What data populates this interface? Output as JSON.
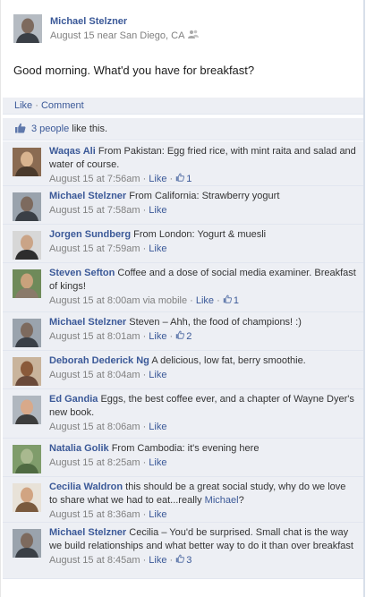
{
  "post": {
    "author": "Michael Stelzner",
    "time": "August 15 near San Diego, CA",
    "message": "Good morning. What'd you have for breakfast?"
  },
  "actions": {
    "like": "Like",
    "separator": "·",
    "comment": "Comment"
  },
  "likes": {
    "count_link": "3 people",
    "suffix": "like this."
  },
  "comments": [
    {
      "author": "Waqas Ali",
      "text": "From Pakistan: Egg fried rice, with mint raita and salad and water of course.",
      "time": "August 15 at 7:56am",
      "like": "Like",
      "likes": "1"
    },
    {
      "author": "Michael Stelzner",
      "text": "From California: Strawberry yogurt",
      "time": "August 15 at 7:58am",
      "like": "Like",
      "likes": ""
    },
    {
      "author": "Jorgen Sundberg",
      "text": "From London: Yogurt & muesli",
      "time": "August 15 at 7:59am",
      "like": "Like",
      "likes": ""
    },
    {
      "author": "Steven Sefton",
      "text": "Coffee and a dose of social media examiner. Breakfast of kings!",
      "time": "August 15 at 8:00am via mobile",
      "like": "Like",
      "likes": "1"
    },
    {
      "author": "Michael Stelzner",
      "text": "Steven – Ahh, the food of champions! :)",
      "time": "August 15 at 8:01am",
      "like": "Like",
      "likes": "2"
    },
    {
      "author": "Deborah Dederick Ng",
      "text": "A delicious, low fat, berry smoothie.",
      "time": "August 15 at 8:04am",
      "like": "Like",
      "likes": ""
    },
    {
      "author": "Ed Gandia",
      "text": "Eggs, the best coffee ever, and a chapter of Wayne Dyer's new book.",
      "time": "August 15 at 8:06am",
      "like": "Like",
      "likes": ""
    },
    {
      "author": "Natalia Golik",
      "text": "From Cambodia: it's evening here",
      "time": "August 15 at 8:25am",
      "like": "Like",
      "likes": ""
    },
    {
      "author": "Cecilia Waldron",
      "text": "this should be a great social study, why do we love to share what we had to eat...really",
      "mention": "Michael",
      "text_end": "?",
      "time": "August 15 at 8:36am",
      "like": "Like",
      "likes": ""
    },
    {
      "author": "Michael Stelzner",
      "text": "Cecilia – You'd be surprised. Small chat is the way we build relationships and what better way to do it than over breakfast",
      "time": "August 15 at 8:45am",
      "like": "Like",
      "likes": "3"
    }
  ],
  "colors": {
    "link": "#3b5998",
    "panel": "#edeff4",
    "meta": "#808080"
  }
}
